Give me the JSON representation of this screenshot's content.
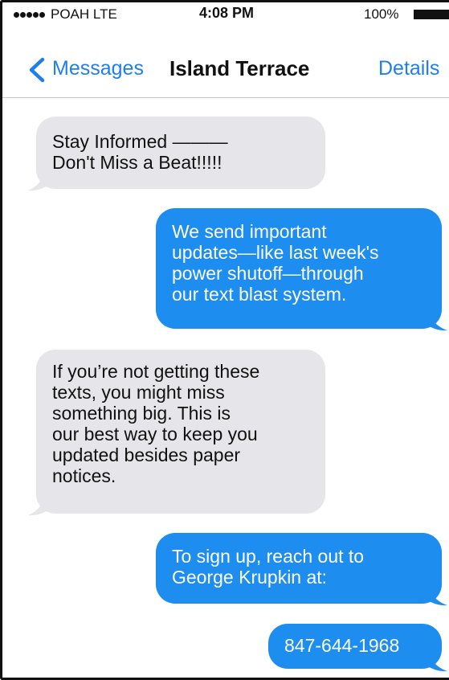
{
  "status_bar": {
    "carrier": "POAH  LTE",
    "time": "4:08 PM",
    "battery": "100%"
  },
  "nav": {
    "back_label": "Messages",
    "title": "Island Terrace",
    "details_label": "Details"
  },
  "messages": [
    {
      "direction": "incoming",
      "text": "Stay Informed ———\nDon't Miss a Beat!!!!!"
    },
    {
      "direction": "outgoing",
      "text": "We send important\nupdates—like last week's\npower shutoff—through\nour text blast system."
    },
    {
      "direction": "incoming",
      "text": "If you’re not getting these\ntexts, you might miss\nsomething big. This is\nour best way to keep you\nupdated besides paper\nnotices."
    },
    {
      "direction": "outgoing",
      "text": "To sign up, reach out to\nGeorge Krupkin at:"
    },
    {
      "direction": "outgoing",
      "text": "847-644-1968"
    }
  ],
  "colors": {
    "incoming_bubble": "#e5e5ea",
    "outgoing_bubble": "#1d8df0",
    "accent": "#1e7ef0"
  }
}
